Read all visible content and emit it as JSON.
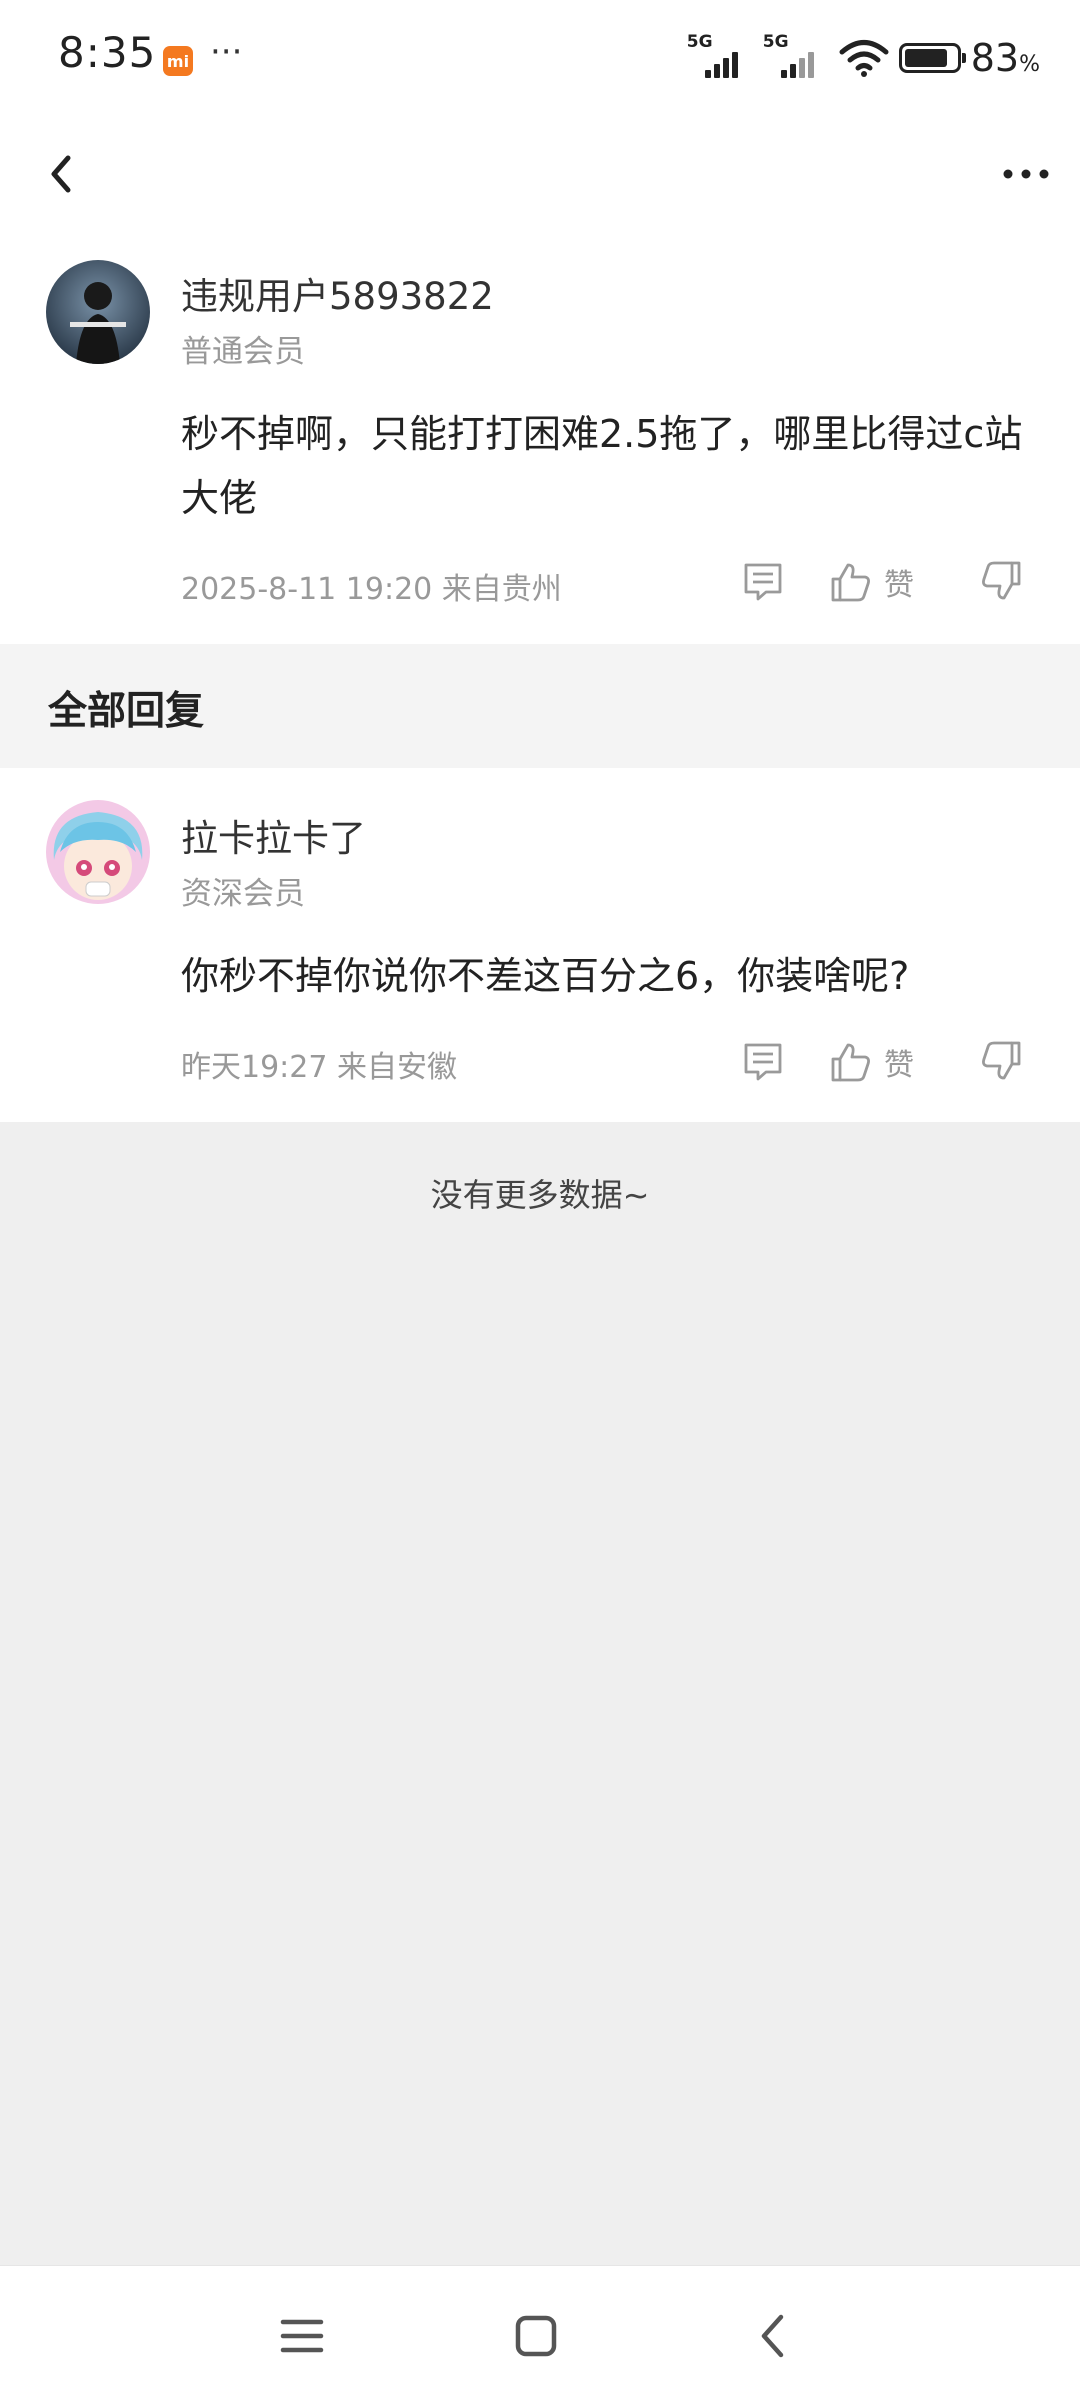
{
  "status_bar": {
    "time": "8:35",
    "mi_badge": "mi",
    "dots": "···",
    "signal_1": "5G",
    "signal_2": "5G",
    "battery_level": 0.83,
    "battery_text": "83",
    "battery_unit": "%"
  },
  "post": {
    "user_name": "违规用户5893822",
    "user_level": "普通会员",
    "content": "秒不掉啊，只能打打困难2.5拖了，哪里比得过c站大佬",
    "time_location": "2025-8-11 19:20  来自贵州",
    "like_label": "赞"
  },
  "section": {
    "title": "全部回复"
  },
  "reply": {
    "user_name": "拉卡拉卡了",
    "user_level": "资深会员",
    "content": "你秒不掉你说你不差这百分之6，你装啥呢?",
    "time_location": "昨天19:27 来自安徽",
    "like_label": "赞"
  },
  "footer": {
    "no_more": "没有更多数据~"
  },
  "icons": {
    "back": "chevron-left-icon",
    "more": "more-horizontal-icon",
    "comment": "comment-icon",
    "like": "thumbs-up-icon",
    "dislike": "thumbs-down-icon",
    "menu": "menu-icon",
    "home": "home-square-icon",
    "nav_back": "nav-back-icon"
  },
  "colors": {
    "accent_badge": "#f47920",
    "meta_gray": "#999999",
    "section_bg": "#f4f4f4"
  }
}
